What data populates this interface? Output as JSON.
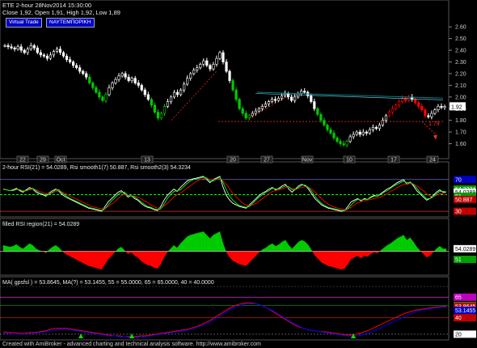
{
  "header": {
    "title": "ETE  2-hour  28Nov2014 15:30:00",
    "ohlc": "Close 1,92, Open 1,91, High 1,92, Low 1,89"
  },
  "buttons": {
    "virtual_trade": "Virtual Trade",
    "nautemporiki": "ΝΑΥΤΕΜΠΟΡΙΚΗ"
  },
  "footer": "Created with AmiBroker - advanced charting and technical analysis software. http://www.amibroker.com",
  "colors": {
    "up": "#00cc00",
    "down": "#ff0000",
    "neutral": "#ffffff",
    "trend": "#008080",
    "support": "#ff3030",
    "rsi": "#ffffff",
    "smooth1": "#ff0000",
    "smooth2": "#00ff00",
    "ma1": "#ff0000",
    "ma2": "#0000ff",
    "fill_up": "#00cc00",
    "fill_down": "#ff0000"
  },
  "chart_data": [
    {
      "type": "candlestick",
      "ylim": [
        1.5,
        2.65
      ],
      "y_ticks": [
        "2.60",
        "2.50",
        "2.40",
        "2.30",
        "2.20",
        "2.10",
        "2.00",
        "1.90",
        "1.80",
        "1.70",
        "1.60"
      ],
      "last_value": "1.92",
      "annotation": "1.79",
      "x_ticks": [
        "22",
        "29",
        "Oct",
        "13",
        "20",
        "27",
        "Nov",
        "10",
        "17",
        "24"
      ],
      "close": [
        2.44,
        2.43,
        2.42,
        2.41,
        2.43,
        2.4,
        2.38,
        2.41,
        2.44,
        2.42,
        2.38,
        2.36,
        2.35,
        2.33,
        2.36,
        2.39,
        2.41,
        2.38,
        2.35,
        2.32,
        2.3,
        2.27,
        2.25,
        2.22,
        2.2,
        2.17,
        2.12,
        2.08,
        2.04,
        2.0,
        1.97,
        2.02,
        2.08,
        2.12,
        2.15,
        2.18,
        2.2,
        2.17,
        2.14,
        2.16,
        2.12,
        2.1,
        2.06,
        2.02,
        1.98,
        1.93,
        1.87,
        1.82,
        1.86,
        1.92,
        1.96,
        2.0,
        2.04,
        2.02,
        2.06,
        2.11,
        2.16,
        2.2,
        2.23,
        2.25,
        2.28,
        2.31,
        2.27,
        2.24,
        2.28,
        2.33,
        2.38,
        2.3,
        2.22,
        2.14,
        2.06,
        1.98,
        1.9,
        1.86,
        1.82,
        1.84,
        1.86,
        1.88,
        1.9,
        1.92,
        1.94,
        1.96,
        1.98,
        1.97,
        1.99,
        2.01,
        2.03,
        2.0,
        1.97,
        2.0,
        2.03,
        2.05,
        2.04,
        2.01,
        1.96,
        1.9,
        1.85,
        1.8,
        1.76,
        1.72,
        1.69,
        1.65,
        1.62,
        1.6,
        1.59,
        1.62,
        1.66,
        1.68,
        1.7,
        1.68,
        1.7,
        1.69,
        1.72,
        1.74,
        1.73,
        1.76,
        1.8,
        1.84,
        1.87,
        1.9,
        1.93,
        1.96,
        1.99,
        1.97,
        2.0,
        1.98,
        1.95,
        1.92,
        1.89,
        1.84,
        1.83,
        1.86,
        1.89,
        1.92,
        1.91,
        1.92
      ]
    },
    {
      "type": "line",
      "title": "2-hour RSI(21) = 54.0289, Rsi smooth1(7) 50.887, Rsi smooth2(3) 54.3234",
      "ylim": [
        25,
        80
      ],
      "levels": [
        70,
        51,
        30
      ],
      "last_values": [
        "70",
        "54.3234",
        "54.0289",
        "51",
        "50.887",
        "30"
      ],
      "series": [
        {
          "name": "RSI(21)",
          "values": [
            58,
            57,
            56,
            57,
            59,
            56,
            54,
            57,
            60,
            58,
            54,
            52,
            51,
            49,
            53,
            56,
            58,
            55,
            51,
            48,
            46,
            44,
            42,
            40,
            38,
            36,
            34,
            33,
            32,
            31,
            30,
            36,
            42,
            46,
            50,
            54,
            56,
            52,
            48,
            50,
            46,
            44,
            40,
            37,
            35,
            34,
            32,
            31,
            36,
            44,
            50,
            54,
            58,
            55,
            60,
            64,
            68,
            70,
            71,
            72,
            73,
            74,
            70,
            66,
            70,
            72,
            74,
            60,
            50,
            44,
            40,
            38,
            36,
            35,
            34,
            38,
            42,
            46,
            50,
            53,
            55,
            58,
            60,
            57,
            59,
            62,
            64,
            58,
            54,
            58,
            62,
            64,
            62,
            58,
            52,
            46,
            42,
            38,
            36,
            34,
            33,
            32,
            31,
            30,
            31,
            36,
            42,
            44,
            46,
            43,
            46,
            45,
            48,
            50,
            49,
            52,
            55,
            58,
            60,
            63,
            66,
            68,
            70,
            64,
            67,
            62,
            56,
            52,
            48,
            44,
            46,
            50,
            54,
            57,
            54,
            54
          ]
        },
        {
          "name": "Rsi smooth1(7)",
          "values": [
            57,
            57,
            56,
            56,
            57,
            57,
            56,
            56,
            57,
            58,
            57,
            55,
            54,
            52,
            52,
            53,
            55,
            56,
            54,
            52,
            50,
            48,
            46,
            44,
            42,
            40,
            38,
            36,
            35,
            34,
            33,
            34,
            36,
            39,
            42,
            46,
            50,
            51,
            50,
            50,
            49,
            48,
            46,
            43,
            41,
            38,
            36,
            34,
            34,
            37,
            40,
            44,
            48,
            51,
            53,
            56,
            59,
            62,
            65,
            68,
            70,
            71,
            71,
            70,
            70,
            70,
            71,
            68,
            64,
            58,
            52,
            48,
            44,
            40,
            38,
            37,
            38,
            40,
            43,
            46,
            49,
            52,
            55,
            56,
            57,
            58,
            60,
            60,
            59,
            58,
            59,
            60,
            61,
            60,
            58,
            54,
            50,
            46,
            42,
            39,
            37,
            35,
            34,
            33,
            32,
            33,
            35,
            38,
            41,
            42,
            43,
            44,
            45,
            46,
            47,
            48,
            50,
            52,
            55,
            57,
            60,
            62,
            64,
            64,
            65,
            64,
            62,
            59,
            56,
            52,
            49,
            49,
            50,
            52,
            52,
            50.887
          ]
        },
        {
          "name": "Rsi smooth2(3)",
          "values": [
            58,
            57,
            56,
            56,
            58,
            57,
            55,
            56,
            58,
            59,
            56,
            53,
            52,
            50,
            51,
            54,
            57,
            57,
            53,
            50,
            47,
            45,
            43,
            41,
            39,
            37,
            35,
            34,
            33,
            32,
            31,
            33,
            38,
            43,
            47,
            51,
            54,
            54,
            50,
            49,
            48,
            45,
            42,
            39,
            36,
            35,
            33,
            32,
            33,
            39,
            46,
            51,
            55,
            56,
            57,
            61,
            65,
            68,
            70,
            71,
            72,
            73,
            72,
            68,
            68,
            71,
            73,
            66,
            57,
            49,
            44,
            40,
            37,
            36,
            35,
            36,
            40,
            44,
            48,
            51,
            54,
            56,
            59,
            58,
            58,
            60,
            62,
            61,
            57,
            57,
            60,
            63,
            63,
            60,
            55,
            49,
            44,
            40,
            37,
            35,
            34,
            33,
            32,
            31,
            31,
            33,
            38,
            42,
            45,
            44,
            45,
            45,
            47,
            49,
            49,
            51,
            54,
            56,
            59,
            62,
            64,
            66,
            68,
            66,
            66,
            64,
            59,
            54,
            50,
            46,
            46,
            48,
            52,
            55,
            55,
            54.3234
          ]
        }
      ]
    },
    {
      "type": "area",
      "title": "filled RSI region(21) = 54.0289",
      "reference": 51,
      "last_values": [
        "54.0289",
        "51"
      ],
      "values": [
        58,
        57,
        56,
        57,
        59,
        56,
        54,
        57,
        60,
        58,
        54,
        52,
        51,
        49,
        53,
        56,
        58,
        55,
        51,
        48,
        46,
        44,
        42,
        40,
        38,
        36,
        34,
        33,
        32,
        31,
        30,
        36,
        42,
        46,
        50,
        54,
        56,
        52,
        48,
        50,
        46,
        44,
        40,
        37,
        35,
        34,
        32,
        31,
        36,
        44,
        50,
        54,
        58,
        55,
        60,
        64,
        68,
        70,
        71,
        72,
        73,
        74,
        70,
        66,
        70,
        72,
        74,
        60,
        50,
        44,
        40,
        38,
        36,
        35,
        34,
        38,
        42,
        46,
        50,
        53,
        55,
        58,
        60,
        57,
        59,
        62,
        64,
        58,
        54,
        58,
        62,
        64,
        62,
        58,
        52,
        46,
        42,
        38,
        36,
        34,
        33,
        32,
        31,
        30,
        31,
        36,
        42,
        44,
        46,
        43,
        46,
        45,
        48,
        50,
        49,
        52,
        55,
        58,
        60,
        63,
        66,
        68,
        70,
        64,
        67,
        62,
        56,
        52,
        48,
        44,
        46,
        50,
        54,
        57,
        54,
        54
      ]
    },
    {
      "type": "line",
      "title": "MA( gpsfsl ) = 53.8645, MA(?) = 53.1455, 55 = 55.0000, 65 = 65.0000, 40 = 40.0000",
      "ylim": [
        15,
        80
      ],
      "levels": [
        65,
        55,
        40,
        20
      ],
      "last_values": [
        "65",
        "55",
        "53.8645",
        "53.1455",
        "40",
        "20"
      ],
      "series": [
        {
          "name": "MA( gpsfsl )",
          "values": [
            23,
            22,
            22,
            21,
            21,
            22,
            22,
            23,
            24,
            26,
            27,
            27,
            27,
            26,
            25,
            24,
            23,
            22,
            21,
            20,
            19,
            18,
            18,
            17,
            17,
            17,
            18,
            18,
            19,
            20,
            21,
            22,
            23,
            24,
            25,
            26,
            28,
            30,
            33,
            36,
            40,
            44,
            48,
            52,
            55,
            57,
            58,
            58,
            57,
            55,
            52,
            48,
            44,
            40,
            36,
            32,
            29,
            27,
            25,
            24,
            23,
            23,
            22,
            21,
            20,
            19,
            19,
            20,
            22,
            24,
            27,
            30,
            33,
            36,
            39,
            42,
            45,
            47,
            49,
            50,
            51,
            52,
            53,
            53.5,
            53.8645
          ]
        },
        {
          "name": "MA(?)",
          "values": [
            21,
            21,
            20,
            20,
            20,
            21,
            21,
            22,
            23,
            24,
            25,
            26,
            26,
            25,
            24,
            23,
            22,
            21,
            20,
            19,
            18,
            18,
            17,
            17,
            16,
            16,
            17,
            17,
            18,
            19,
            20,
            21,
            22,
            23,
            24,
            25,
            27,
            29,
            31,
            34,
            38,
            42,
            46,
            50,
            53,
            55,
            57,
            57,
            57,
            55,
            52,
            49,
            45,
            41,
            37,
            33,
            30,
            27,
            25,
            24,
            23,
            22,
            21,
            20,
            19,
            18,
            18,
            18,
            19,
            21,
            23,
            26,
            29,
            32,
            35,
            38,
            41,
            44,
            47,
            49,
            50,
            51,
            52,
            52.8,
            53.1455
          ]
        }
      ],
      "signals": [
        "up",
        "up",
        "up",
        "down",
        "up"
      ]
    }
  ]
}
